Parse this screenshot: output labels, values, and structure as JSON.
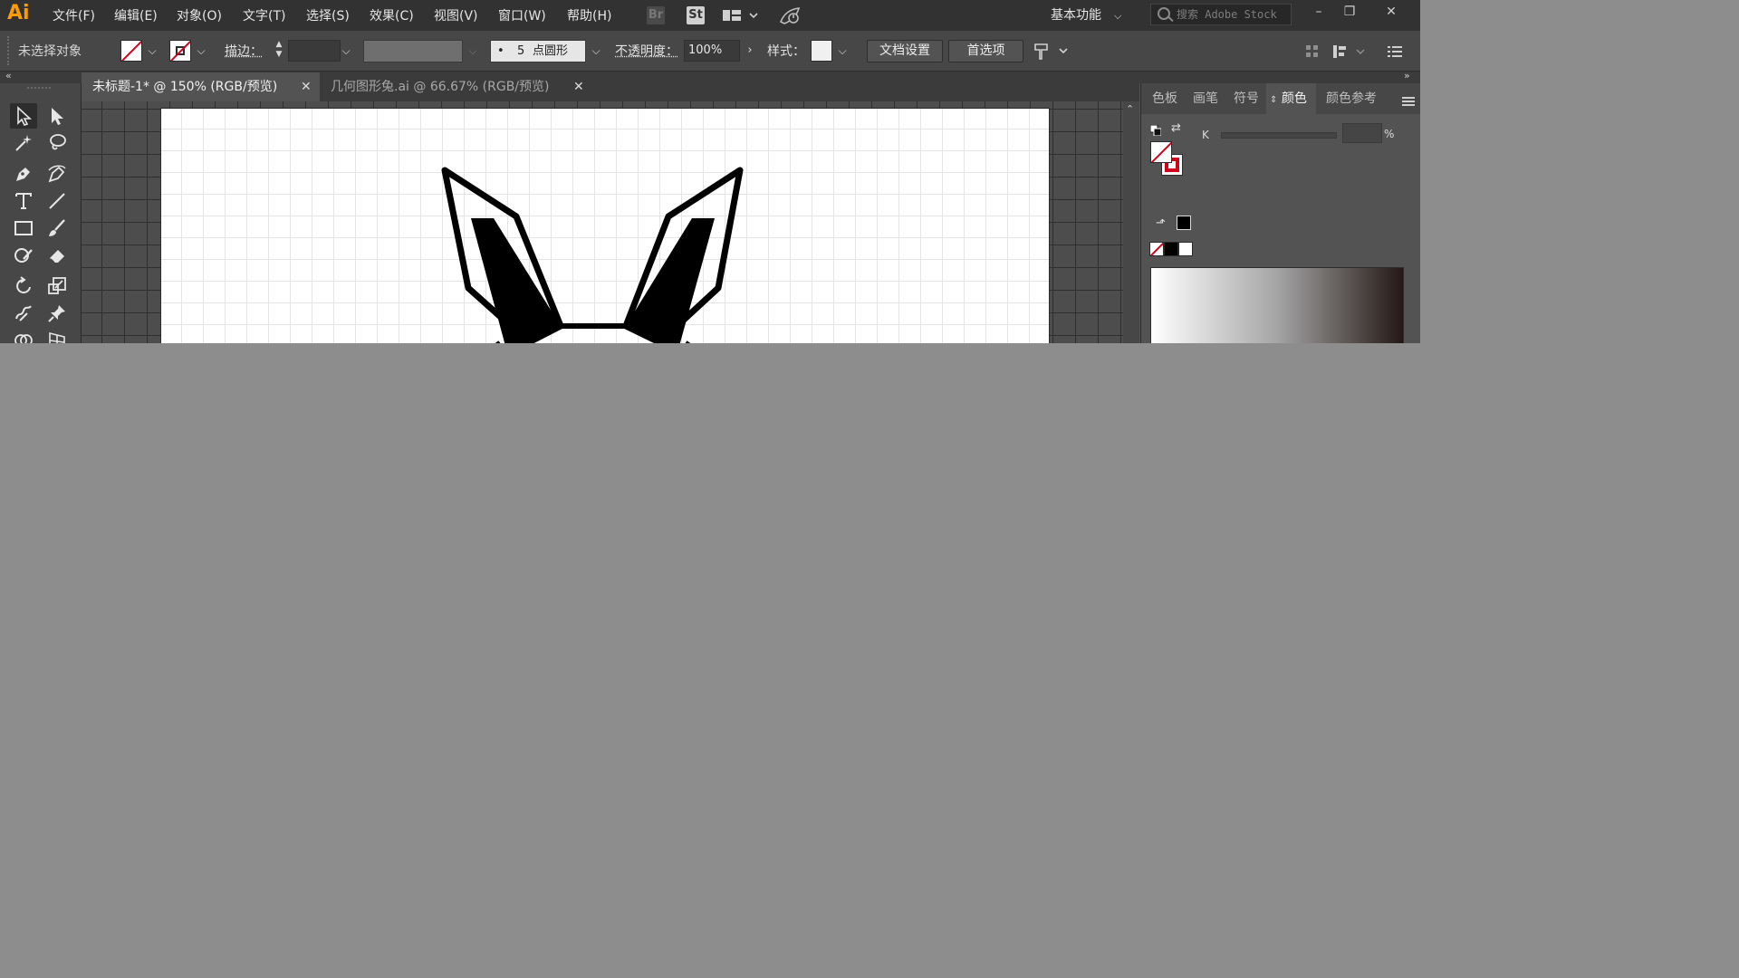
{
  "app": {
    "logo": "Ai",
    "menu": [
      "文件(F)",
      "编辑(E)",
      "对象(O)",
      "文字(T)",
      "选择(S)",
      "效果(C)",
      "视图(V)",
      "窗口(W)",
      "帮助(H)"
    ],
    "bridge_label": "Br",
    "stock_label": "St",
    "workspace": "基本功能",
    "search_placeholder": "搜索 Adobe Stock",
    "window_buttons": {
      "minimize": "–",
      "restore": "❐",
      "close": "✕"
    }
  },
  "control_bar": {
    "selection_status": "未选择对象",
    "stroke_label": "描边：",
    "brush_dot": "•",
    "brush_size": "5",
    "brush_shape": "点圆形",
    "opacity_label": "不透明度：",
    "opacity_value": "100%",
    "style_label": "样式：",
    "doc_setup_button": "文档设置",
    "preferences_button": "首选项"
  },
  "document_tabs": [
    {
      "title": "未标题-1* @ 150% (RGB/预览)",
      "active": true
    },
    {
      "title": "几何图形兔.ai @ 66.67% (RGB/预览)",
      "active": false
    }
  ],
  "tab_close": "✕",
  "panel": {
    "tabs": [
      "色板",
      "画笔",
      "符号",
      "颜色",
      "颜色参考"
    ],
    "active_tab": "颜色",
    "k_label": "K",
    "percent": "%",
    "stroke_swatch_color": "#000000"
  },
  "colors": {
    "accent_logo": "#ff9a00",
    "none_slash": "#d0021b"
  }
}
